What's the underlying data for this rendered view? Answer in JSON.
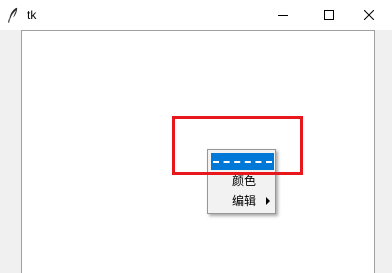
{
  "window": {
    "title": "tk",
    "icons": {
      "app": "feather-icon",
      "minimize": "minimize-icon",
      "maximize": "maximize-icon",
      "close": "close-icon"
    }
  },
  "context_menu": {
    "tearoff": "tearoff-separator",
    "items": [
      {
        "label": "颜色",
        "has_submenu": false
      },
      {
        "label": "编辑",
        "has_submenu": true
      }
    ],
    "selection_color": "#0078d7"
  },
  "annotation": {
    "highlight_color": "#e8171b"
  }
}
